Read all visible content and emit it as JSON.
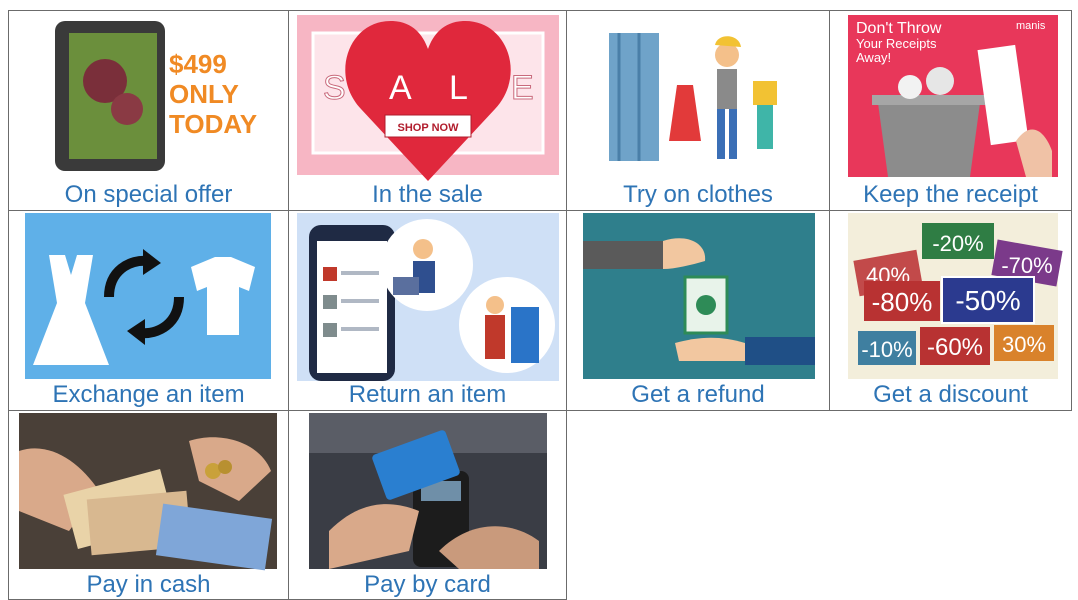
{
  "cards": [
    {
      "caption": "On special offer",
      "price": "$499",
      "line1": "ONLY",
      "line2": "TODAY"
    },
    {
      "caption": "In the sale",
      "letters": [
        "S",
        "A",
        "L",
        "E"
      ],
      "button": "SHOP NOW"
    },
    {
      "caption": "Try on clothes"
    },
    {
      "caption": "Keep the receipt",
      "headline": [
        "Don't Throw",
        "Your Receipts",
        "Away!"
      ],
      "brand": "manis"
    },
    {
      "caption": "Exchange an item"
    },
    {
      "caption": "Return an item"
    },
    {
      "caption": "Get a refund"
    },
    {
      "caption": "Get a discount",
      "tags": [
        "-20%",
        "40%",
        "-70%",
        "-80%",
        "-50%",
        "-10%",
        "-60%",
        "30%"
      ]
    },
    {
      "caption": "Pay in cash"
    },
    {
      "caption": "Pay by card"
    }
  ],
  "colors": {
    "caption": "#2e74b5",
    "border": "#6b6b6b"
  }
}
